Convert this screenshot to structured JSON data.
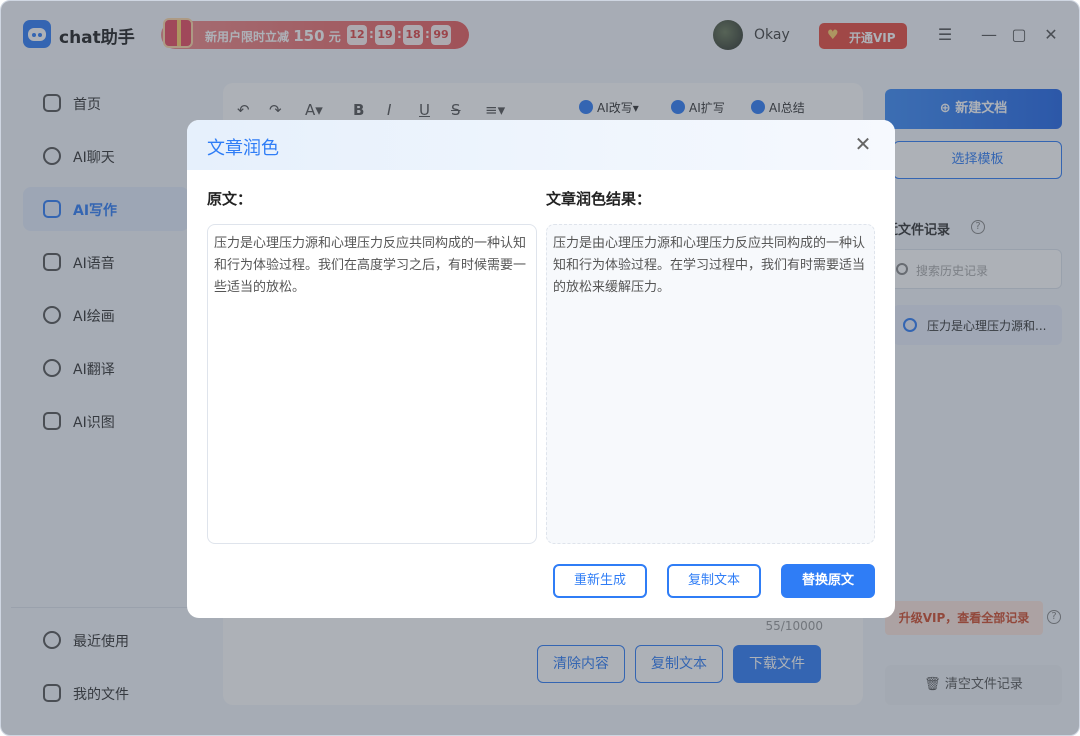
{
  "app": {
    "title": "chat助手",
    "username": "Okay",
    "vip_label": "开通VIP"
  },
  "promo": {
    "text": "新用户限时立减",
    "amount": "150",
    "unit": "元",
    "timer": [
      "12",
      "19",
      "18",
      "99"
    ]
  },
  "sidebar": {
    "items": [
      {
        "label": "首页",
        "icon": "home-icon"
      },
      {
        "label": "AI聊天",
        "icon": "chat-icon"
      },
      {
        "label": "AI写作",
        "icon": "pen-icon",
        "active": true
      },
      {
        "label": "AI语音",
        "icon": "voice-icon"
      },
      {
        "label": "AI绘画",
        "icon": "palette-icon"
      },
      {
        "label": "AI翻译",
        "icon": "translate-icon"
      },
      {
        "label": "AI识图",
        "icon": "scan-icon"
      }
    ],
    "bottom": [
      {
        "label": "最近使用",
        "icon": "history-icon"
      },
      {
        "label": "我的文件",
        "icon": "file-icon"
      }
    ]
  },
  "editor": {
    "toolbar_ai": [
      "AI改写",
      "AI扩写",
      "AI总结"
    ],
    "counter": "55/10000",
    "buttons": {
      "clear": "清除内容",
      "copy": "复制文本",
      "download": "下载文件"
    }
  },
  "right_panel": {
    "new_doc": "新建文档",
    "select_template": "选择模板",
    "recent_title": "近文件记录",
    "search_placeholder": "搜索历史记录",
    "file_item": "压力是心理压力源和...",
    "upgrade": "升级VIP，查看全部记录",
    "clear_records": "清空文件记录"
  },
  "modal": {
    "title": "文章润色",
    "original_label": "原文：",
    "result_label": "文章润色结果：",
    "original_text": "压力是心理压力源和心理压力反应共同构成的一种认知和行为体验过程。我们在高度学习之后，有时候需要一些适当的放松。",
    "result_text": "压力是由心理压力源和心理压力反应共同构成的一种认知和行为体验过程。在学习过程中，我们有时需要适当的放松来缓解压力。",
    "buttons": {
      "regenerate": "重新生成",
      "copy": "复制文本",
      "replace": "替换原文"
    }
  },
  "colors": {
    "accent": "#2f7df6",
    "vip_red": "#e84a3f"
  }
}
